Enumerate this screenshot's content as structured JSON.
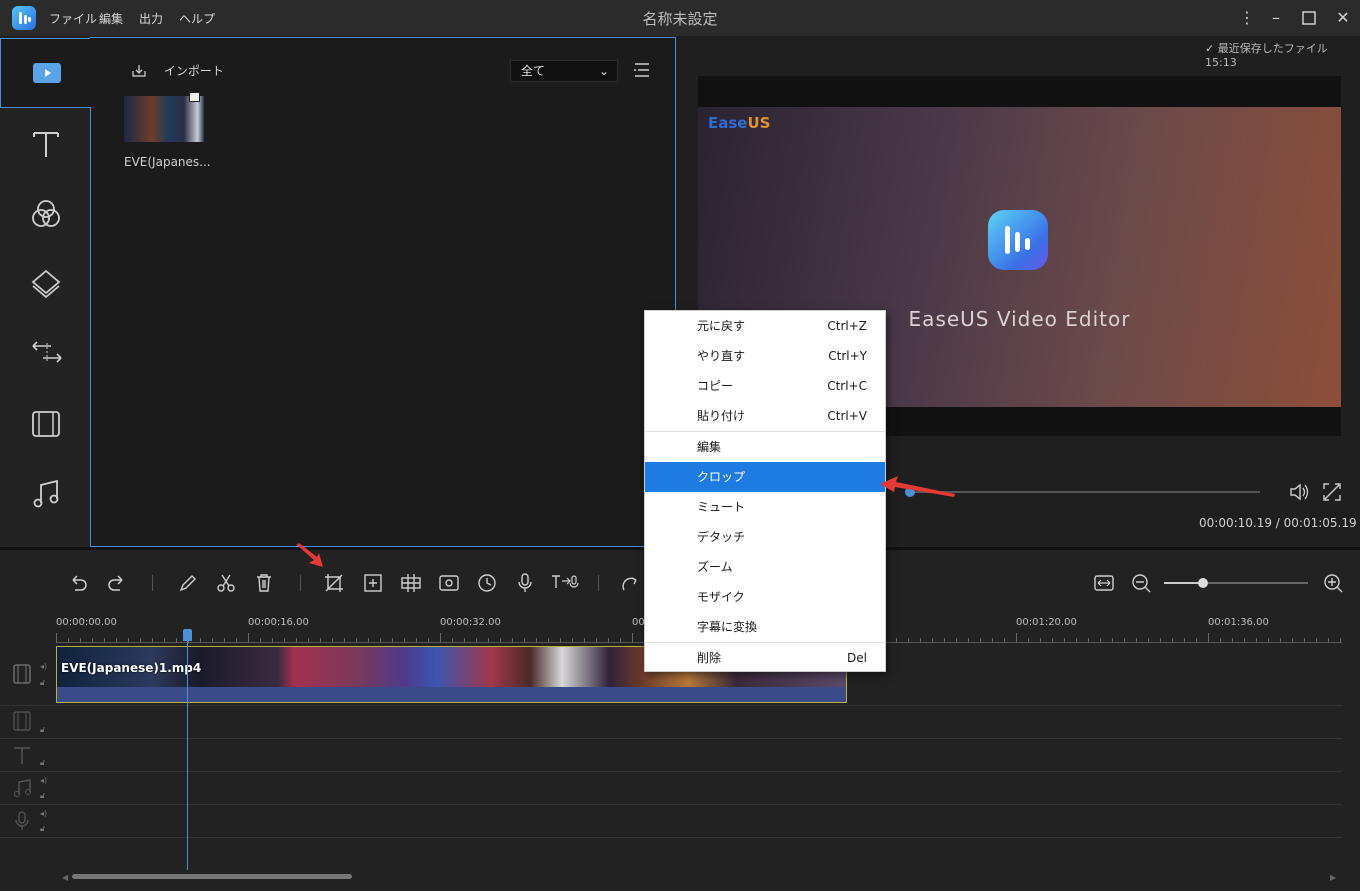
{
  "app": {
    "window_title": "名称未設定",
    "menus": [
      "ファイル",
      "編集",
      "出力",
      "ヘルプ"
    ]
  },
  "media": {
    "import_label": "インポート",
    "filter_value": "全て",
    "items": [
      {
        "name": "EVE(Japanes..."
      }
    ]
  },
  "preview": {
    "last_saved": "最近保存したファイル 15:13",
    "logo_main": "Ease",
    "logo_accent": "US",
    "caption": "EaseUS Video Editor",
    "timecode": "00:00:10.19 / 00:01:05.19",
    "progress_fraction": 0.15
  },
  "timeline": {
    "ticks": [
      "00:00:00.00",
      "00:00:16.00",
      "00:00:32.00",
      "00:01:20.00",
      "00:01:36.00"
    ],
    "partial_tick": "00",
    "clip_name": "EVE(Japanese)1.mp4",
    "zoom_fraction": 0.27
  },
  "context_menu": {
    "items": [
      {
        "label": "元に戻す",
        "shortcut": "Ctrl+Z"
      },
      {
        "label": "やり直す",
        "shortcut": "Ctrl+Y"
      },
      {
        "label": "コピー",
        "shortcut": "Ctrl+C"
      },
      {
        "label": "貼り付け",
        "shortcut": "Ctrl+V"
      },
      {
        "label": "編集",
        "shortcut": ""
      },
      {
        "label": "クロップ",
        "shortcut": ""
      },
      {
        "label": "ミュート",
        "shortcut": ""
      },
      {
        "label": "デタッチ",
        "shortcut": ""
      },
      {
        "label": "ズーム",
        "shortcut": ""
      },
      {
        "label": "モザイク",
        "shortcut": ""
      },
      {
        "label": "字幕に変換",
        "shortcut": ""
      },
      {
        "label": "削除",
        "shortcut": "Del"
      }
    ],
    "active_item": "クロップ"
  },
  "colors": {
    "accent": "#4b8fd6",
    "highlight": "#1e7be1",
    "annotation_arrow": "#e53935"
  }
}
